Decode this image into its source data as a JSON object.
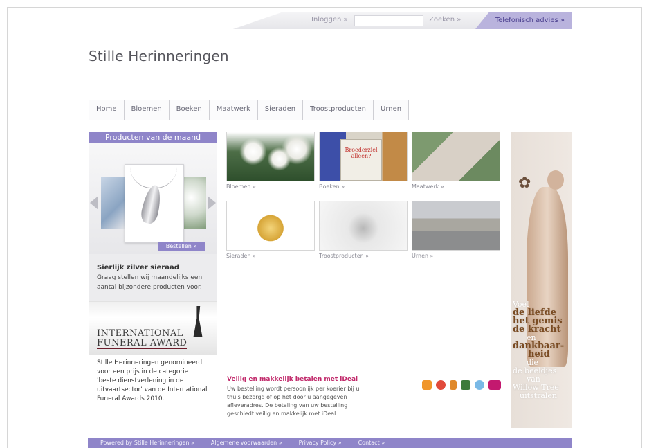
{
  "topbar": {
    "login": "Inloggen »",
    "search_placeholder": "",
    "search_button": "Zoeken »",
    "phone_advice": "Telefonisch advies »"
  },
  "site": {
    "title": "Stille Herinneringen"
  },
  "nav": {
    "items": [
      "Home",
      "Bloemen",
      "Boeken",
      "Maatwerk",
      "Sieraden",
      "Troostproducten",
      "Urnen"
    ]
  },
  "product_month": {
    "header": "Producten van de maand",
    "order_button": "Bestellen »",
    "title": "Sierlijk zilver sieraad",
    "description": "Graag stellen wij maandelijks een aantal bijzondere producten voor."
  },
  "award": {
    "line1": "INTERNATIONAL",
    "line2": "FUNERAL AWARD",
    "description": "Stille Herinneringen genomineerd voor een prijs in de categorie 'beste dienstverlening in de uitvaartsector' van de International Funeral Awards 2010."
  },
  "categories": [
    {
      "label": "Bloemen »"
    },
    {
      "label": "Boeken »",
      "cover_text": "Broederziel alleen?"
    },
    {
      "label": "Maatwerk »"
    },
    {
      "label": "Sieraden »"
    },
    {
      "label": "Troostproducten »"
    },
    {
      "label": "Urnen »"
    }
  ],
  "ideal": {
    "title": "Veilig en makkelijk betalen met iDeal",
    "description": "Uw bestelling wordt persoonlijk per koerier bij u thuis bezorgd of op het door u aangegeven afleveradres. De betaling van uw bestelling geschiedt veilig en makkelijk met iDeal."
  },
  "banner": {
    "poem": [
      "Voel",
      "de liefde",
      "het gemis",
      "de kracht",
      "en",
      "dankbaar-",
      "heid",
      "die",
      "de beeldjes",
      "van",
      "Willow Tree",
      "uitstralen"
    ]
  },
  "footer": {
    "items": [
      "Powered by Stille Herinneringen »",
      "Algemene voorwaarden »",
      "Privacy Policy »",
      "Contact »"
    ]
  },
  "colors": {
    "accent": "#8f85c9",
    "ideal_pink": "#c12a6b",
    "text_grey": "#55555c"
  }
}
